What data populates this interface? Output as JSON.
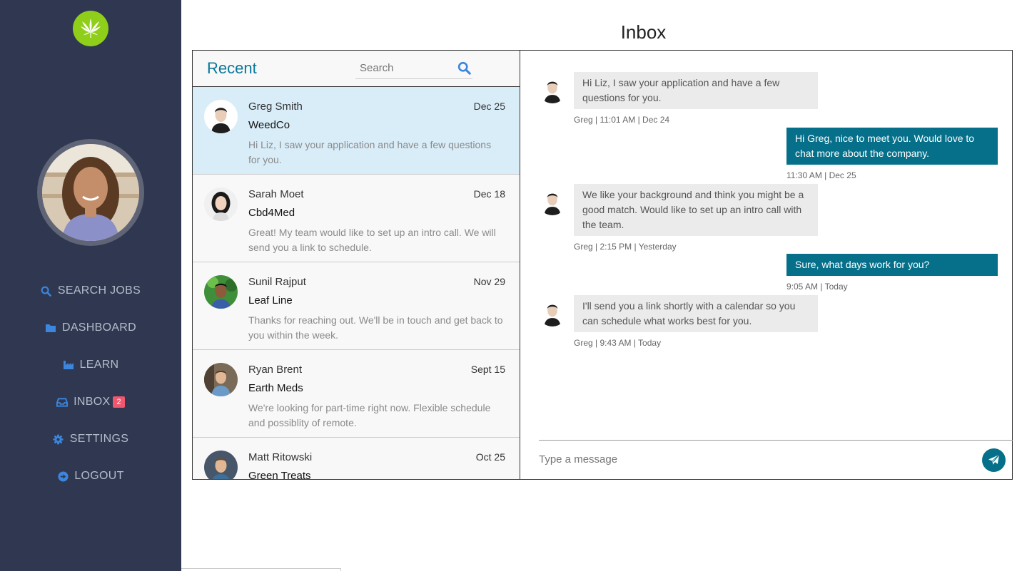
{
  "page": {
    "title": "Inbox"
  },
  "colors": {
    "sidebar": "#2f3850",
    "accent": "#0a7799",
    "sent_bubble": "#06708a",
    "badge": "#f0566e",
    "logo": "#8fce19"
  },
  "sidebar": {
    "logo_icon": "cannabis-leaf-icon",
    "items": [
      {
        "label": "SEARCH JOBS",
        "icon": "search-icon"
      },
      {
        "label": "DASHBOARD",
        "icon": "folder-icon"
      },
      {
        "label": "LEARN",
        "icon": "industry-icon"
      },
      {
        "label": "INBOX",
        "icon": "inbox-icon",
        "badge": "2"
      },
      {
        "label": "SETTINGS",
        "icon": "gear-icon"
      },
      {
        "label": "LOGOUT",
        "icon": "arrow-circle-right-icon"
      }
    ]
  },
  "list": {
    "heading": "Recent",
    "search": {
      "placeholder": "Search"
    },
    "conversations": [
      {
        "name": "Greg Smith",
        "date": "Dec 25",
        "company": "WeedCo",
        "preview": "Hi Liz, I saw your application and have a few questions for you."
      },
      {
        "name": "Sarah Moet",
        "date": "Dec 18",
        "company": "Cbd4Med",
        "preview": "Great! My team would like to set up an intro call. We will send you a link to schedule."
      },
      {
        "name": "Sunil Rajput",
        "date": "Nov 29",
        "company": "Leaf Line",
        "preview": "Thanks for reaching out. We'll be in touch and get back to you within the week."
      },
      {
        "name": "Ryan Brent",
        "date": "Sept 15",
        "company": "Earth Meds",
        "preview": "We're looking for part-time right now. Flexible schedule and possiblity of remote."
      },
      {
        "name": "Matt Ritowski",
        "date": "Oct 25",
        "company": "Green Treats",
        "preview": ""
      }
    ]
  },
  "chat": {
    "messages": [
      {
        "direction": "in",
        "text": "Hi Liz, I saw your application and have a few questions for you.",
        "meta": "Greg | 11:01 AM | Dec 24"
      },
      {
        "direction": "out",
        "text": "Hi Greg, nice to meet you. Would love to chat more about the company.",
        "meta": "11:30 AM | Dec 25"
      },
      {
        "direction": "in",
        "text": "We like your background and think you might be a good match. Would like to set up an intro call with the team.",
        "meta": "Greg | 2:15 PM | Yesterday"
      },
      {
        "direction": "out",
        "text": "Sure, what days work for you?",
        "meta": "9:05 AM | Today"
      },
      {
        "direction": "in",
        "text": "I'll send you a link shortly with a calendar so you can schedule what works best for you.",
        "meta": "Greg | 9:43 AM | Today"
      }
    ],
    "composer": {
      "placeholder": "Type a message"
    },
    "send_icon": "paper-plane-icon"
  }
}
